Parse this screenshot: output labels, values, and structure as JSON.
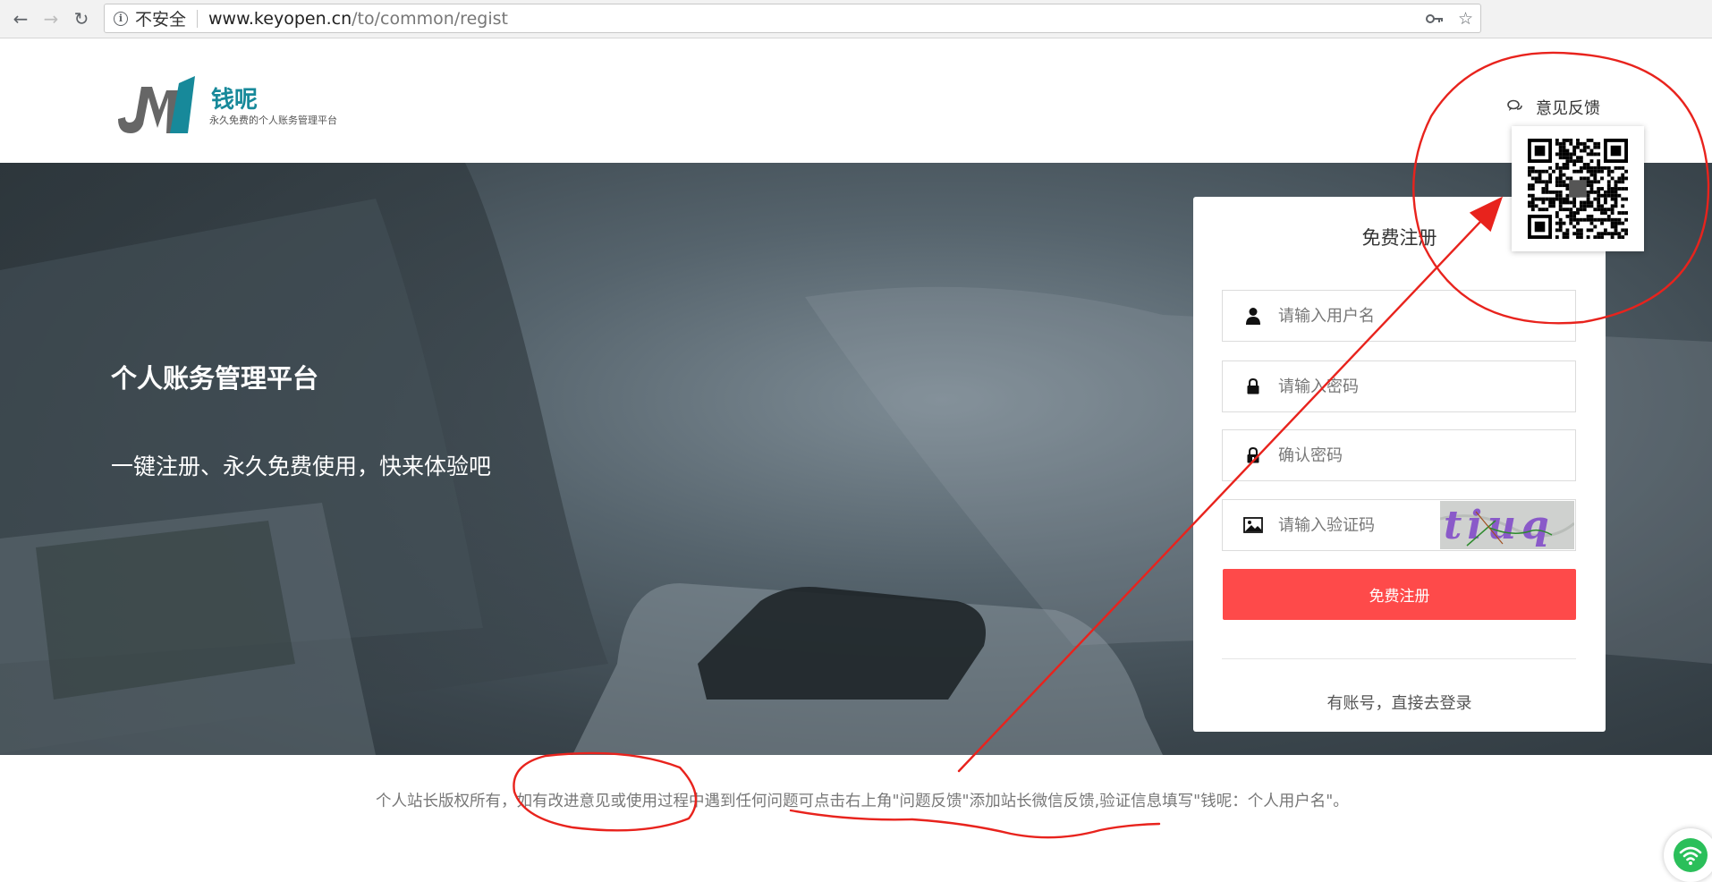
{
  "browser": {
    "security_label": "不安全",
    "url_domain": "www.keyopen.cn",
    "url_path": "/to/common/regist"
  },
  "header": {
    "logo_name": "钱呢",
    "logo_slogan": "永久免费的个人账务管理平台",
    "feedback_label": "意见反馈"
  },
  "hero": {
    "title": "个人账务管理平台",
    "subtitle": "一键注册、永久免费使用，快来体验吧"
  },
  "register": {
    "title": "免费注册",
    "username_placeholder": "请输入用户名",
    "password_placeholder": "请输入密码",
    "confirm_placeholder": "确认密码",
    "captcha_placeholder": "请输入验证码",
    "captcha_text": "tiuq",
    "submit_label": "免费注册",
    "login_link": "有账号，直接去登录"
  },
  "footer": {
    "text": "个人站长版权所有，如有改进意见或使用过程中遇到任何问题可点击右上角\"问题反馈\"添加站长微信反馈,验证信息填写\"钱呢：个人用户名\"。"
  },
  "colors": {
    "brand": "#17899a",
    "accent_button": "#fe4a4a",
    "annotation": "#e8231d"
  }
}
